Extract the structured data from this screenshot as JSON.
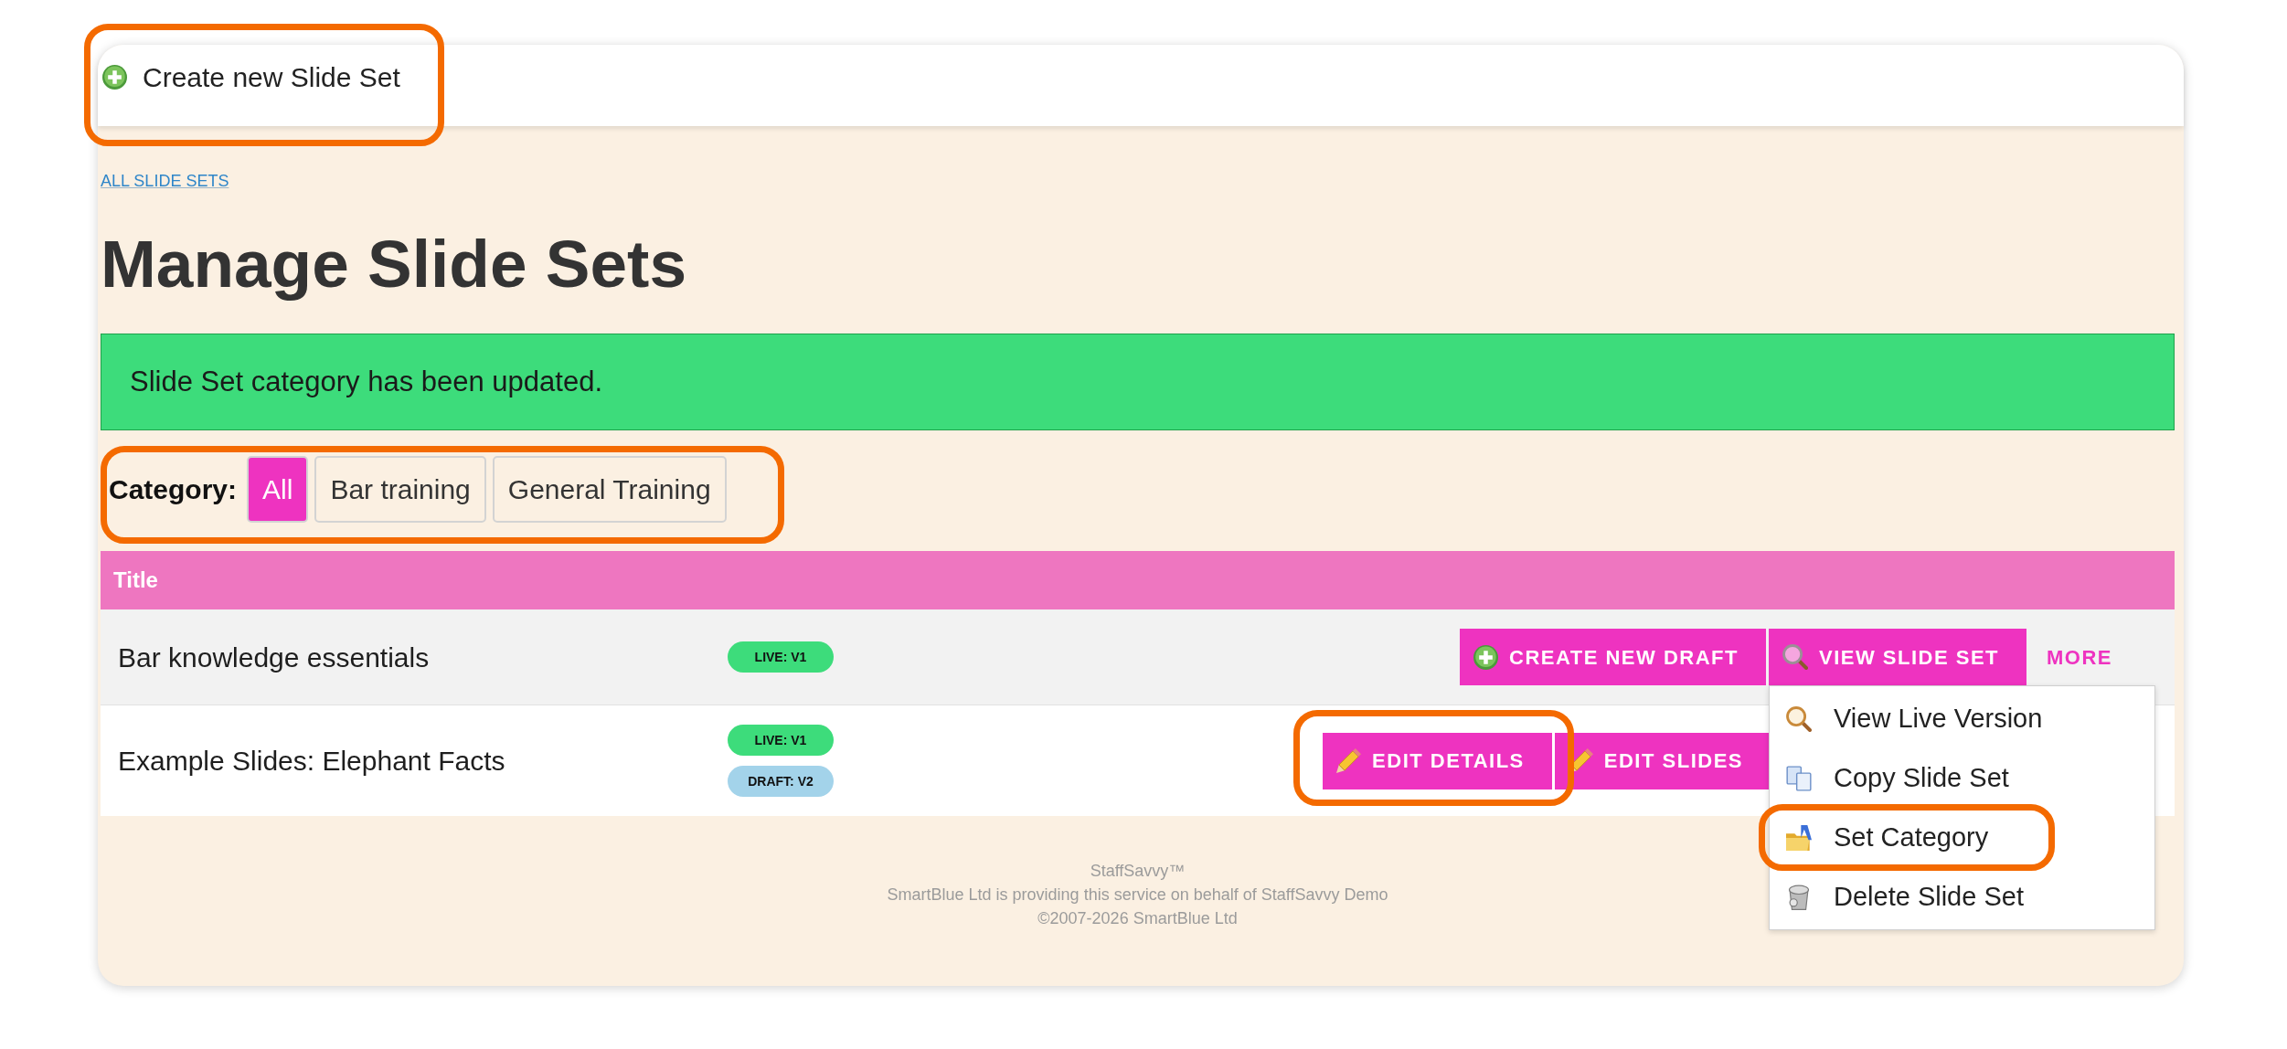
{
  "header": {
    "action": {
      "label": "Create new Slide Set",
      "highlighted": true
    }
  },
  "breadcrumb": {
    "label": "ALL SLIDE SETS"
  },
  "page_title": "Manage Slide Sets",
  "alert": {
    "kind": "success",
    "message": "Slide Set category has been updated."
  },
  "category_filter": {
    "label": "Category:",
    "highlighted": true,
    "options": [
      {
        "label": "All",
        "selected": true
      },
      {
        "label": "Bar training",
        "selected": false
      },
      {
        "label": "General Training",
        "selected": false
      }
    ]
  },
  "table": {
    "columns": [
      {
        "label": "Title"
      }
    ],
    "rows": [
      {
        "title": "Bar knowledge essentials",
        "badges": [
          {
            "kind": "live",
            "label": "LIVE: V1"
          }
        ],
        "actions": [
          {
            "kind": "create",
            "label": "CREATE NEW DRAFT",
            "highlighted": false
          },
          {
            "kind": "view",
            "label": "VIEW SLIDE SET",
            "highlighted": false
          }
        ],
        "more": {
          "label": "MORE",
          "expanded": true,
          "menu": [
            {
              "kind": "view",
              "label": "View Live Version",
              "highlighted": false
            },
            {
              "kind": "copy",
              "label": "Copy Slide Set",
              "highlighted": false
            },
            {
              "kind": "category",
              "label": "Set Category",
              "highlighted": true
            },
            {
              "kind": "delete",
              "label": "Delete Slide Set",
              "highlighted": false
            }
          ]
        }
      },
      {
        "title": "Example Slides: Elephant Facts",
        "badges": [
          {
            "kind": "live",
            "label": "LIVE: V1"
          },
          {
            "kind": "draft",
            "label": "DRAFT: V2"
          }
        ],
        "actions": [
          {
            "kind": "edit",
            "label": "EDIT DETAILS",
            "highlighted": true
          },
          {
            "kind": "edit",
            "label": "EDIT SLIDES",
            "highlighted": false
          }
        ]
      }
    ]
  },
  "footer": {
    "lines": [
      "StaffSavvy™",
      "SmartBlue Ltd is providing this service on behalf of StaffSavvy Demo",
      "©2007-2026 SmartBlue Ltd"
    ]
  }
}
